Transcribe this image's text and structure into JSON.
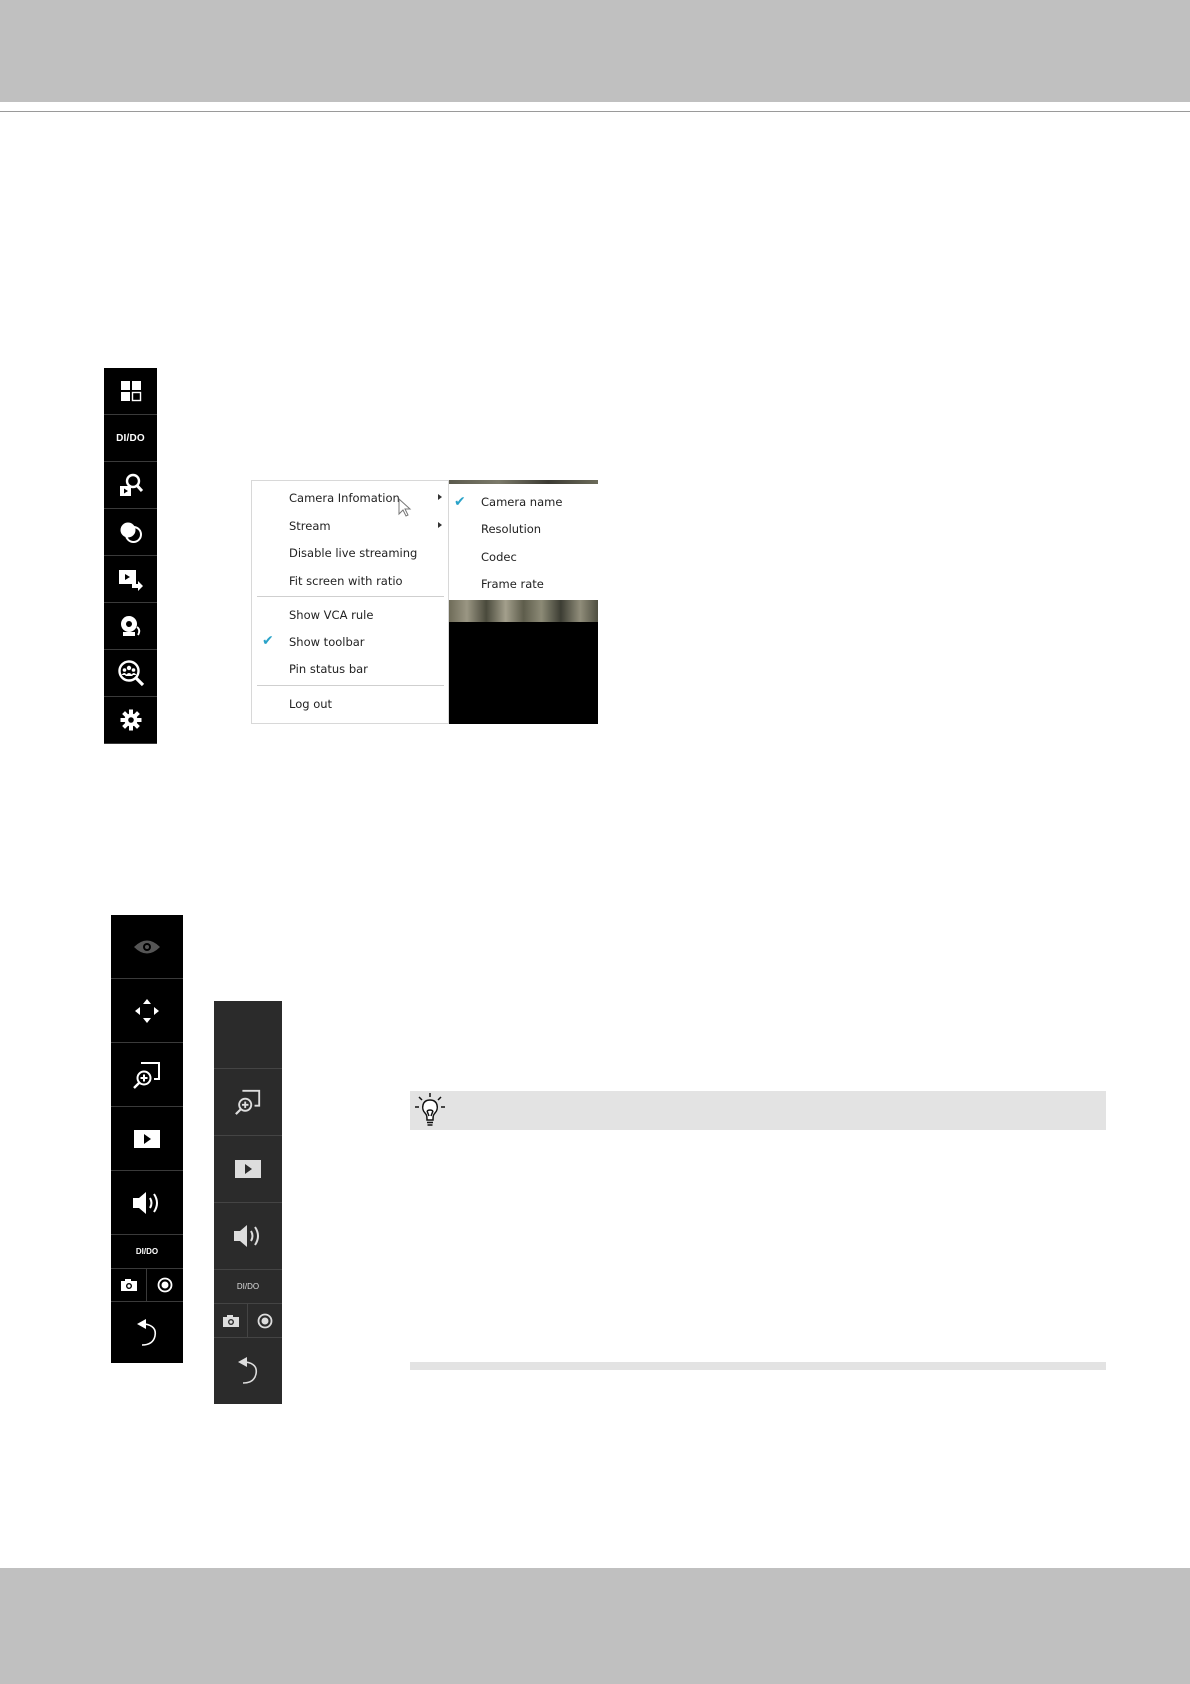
{
  "toolbar1": {
    "items": [
      {
        "icon": "layout-grid-icon"
      },
      {
        "icon": "di-do-icon",
        "label": "DI/DO"
      },
      {
        "icon": "search-playback-icon"
      },
      {
        "icon": "mask-overlay-icon"
      },
      {
        "icon": "export-video-icon"
      },
      {
        "icon": "speaker-alert-icon"
      },
      {
        "icon": "people-search-icon"
      },
      {
        "icon": "gear-icon"
      }
    ]
  },
  "context_menu": {
    "items": [
      {
        "label": "Camera Infomation",
        "has_submenu": true,
        "checked": false
      },
      {
        "label": "Stream",
        "has_submenu": true,
        "checked": false
      },
      {
        "label": "Disable live streaming",
        "has_submenu": false,
        "checked": false
      },
      {
        "label": "Fit screen with ratio",
        "has_submenu": false,
        "checked": false
      },
      {
        "label": "Show VCA rule",
        "has_submenu": false,
        "checked": false
      },
      {
        "label": "Show toolbar",
        "has_submenu": false,
        "checked": true
      },
      {
        "label": "Pin status bar",
        "has_submenu": false,
        "checked": false
      },
      {
        "label": "Log out",
        "has_submenu": false,
        "checked": false
      }
    ],
    "submenu": [
      {
        "label": "Camera name",
        "checked": true
      },
      {
        "label": "Resolution",
        "checked": false
      },
      {
        "label": "Codec",
        "checked": false
      },
      {
        "label": "Frame rate",
        "checked": false
      }
    ],
    "check_color": "#2aa3c9"
  },
  "toolbar2": {
    "items": [
      "eye-icon",
      "pan-arrows-icon",
      "zoom-in-icon",
      "play-icon",
      "volume-icon"
    ],
    "dido_label": "DI/DO",
    "bottom": [
      "camera-snapshot-icon",
      "record-icon",
      "undo-icon"
    ]
  },
  "toolbar3": {
    "items": [
      "blank",
      "zoom-in-icon",
      "play-icon",
      "volume-icon"
    ],
    "dido_label": "DI/DO",
    "bottom": [
      "camera-snapshot-icon",
      "record-icon",
      "undo-icon"
    ]
  },
  "tip": {
    "icon": "lightbulb-icon"
  },
  "colors": {
    "band": "#c0c0c0",
    "tip_bg": "#e3e3e3",
    "toolbar_dark": "#000000",
    "toolbar_gray": "#2b2b2b"
  }
}
